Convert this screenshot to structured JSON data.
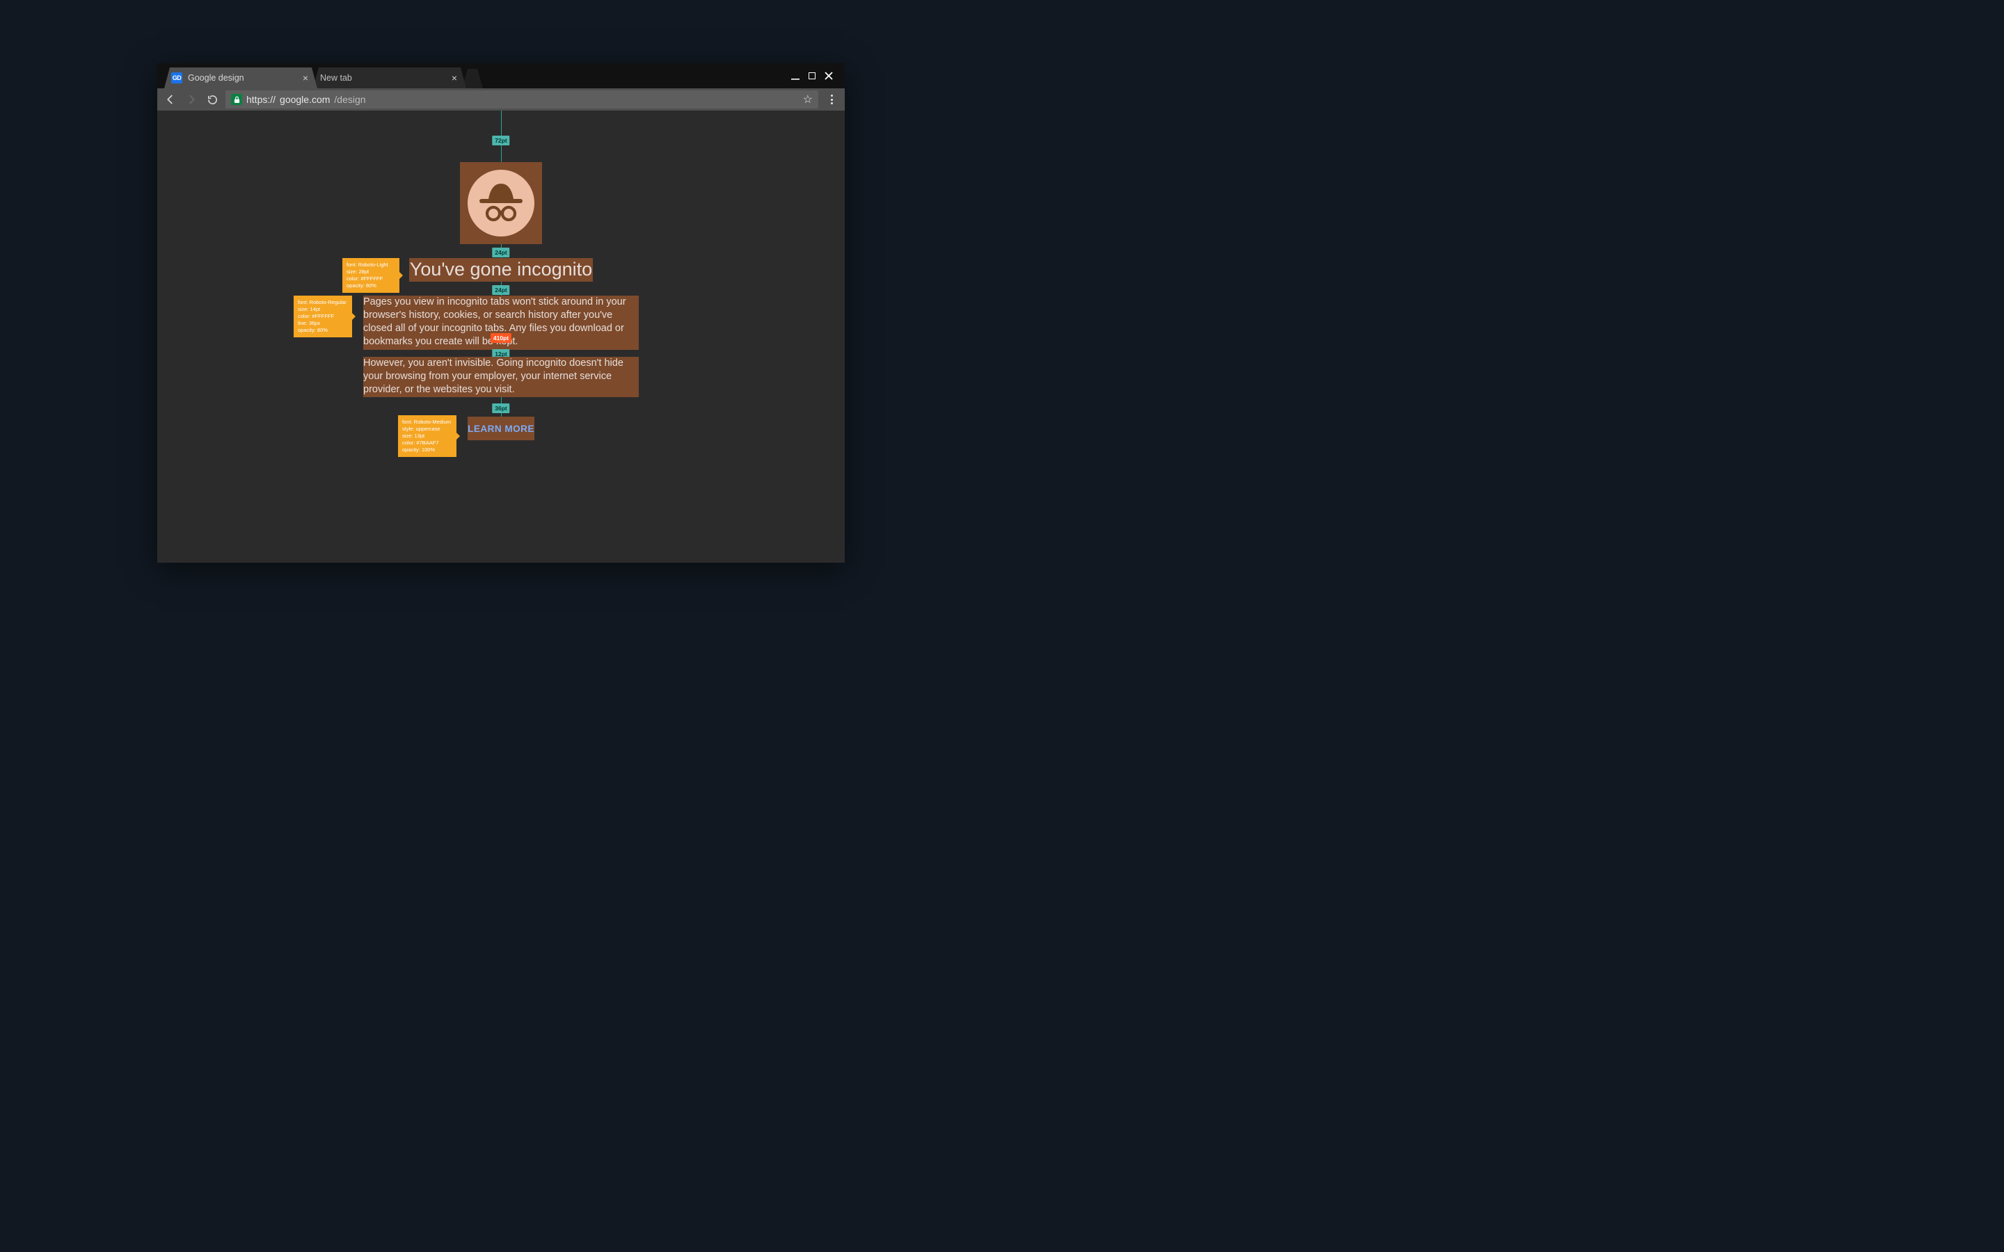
{
  "tabs": [
    {
      "title": "Google design",
      "favicon": "GD",
      "active": true
    },
    {
      "title": "New tab",
      "active": false
    }
  ],
  "url": {
    "scheme": "https://",
    "host": "google.com",
    "path": "/design"
  },
  "page": {
    "heading": "You've gone incognito",
    "p1": "Pages you view in incognito tabs won't stick around in your browser's history, cookies, or search history after you've closed all of your incognito tabs. Any files you download or bookmarks you create will be kept.",
    "p2": "However, you aren't invisible. Going incognito doesn't hide your browsing from your employer, your internet service provider, or the websites you visit.",
    "button": "LEARN MORE"
  },
  "spacing": {
    "s72": "72pt",
    "s24a": "24pt",
    "s24b": "24pt",
    "s410": "410pt",
    "s12": "12pt",
    "s36": "36pt"
  },
  "spec_heading": {
    "l1": "font: Roboto-Light",
    "l2": "size: 28pt",
    "l3": "color: #FFFFFF",
    "l4": "opacity: 80%"
  },
  "spec_body": {
    "l1": "font: Roboto-Regular",
    "l2": "size: 14pt",
    "l3": "color: #FFFFFF",
    "l4": "line: 36px",
    "l5": "opacity: 80%"
  },
  "spec_button": {
    "l1": "font: Roboto-Medium",
    "l2": "style: uppercase",
    "l3": "size: 13pt",
    "l4": "color: #7BAAF7",
    "l5": "opacity: 100%"
  }
}
